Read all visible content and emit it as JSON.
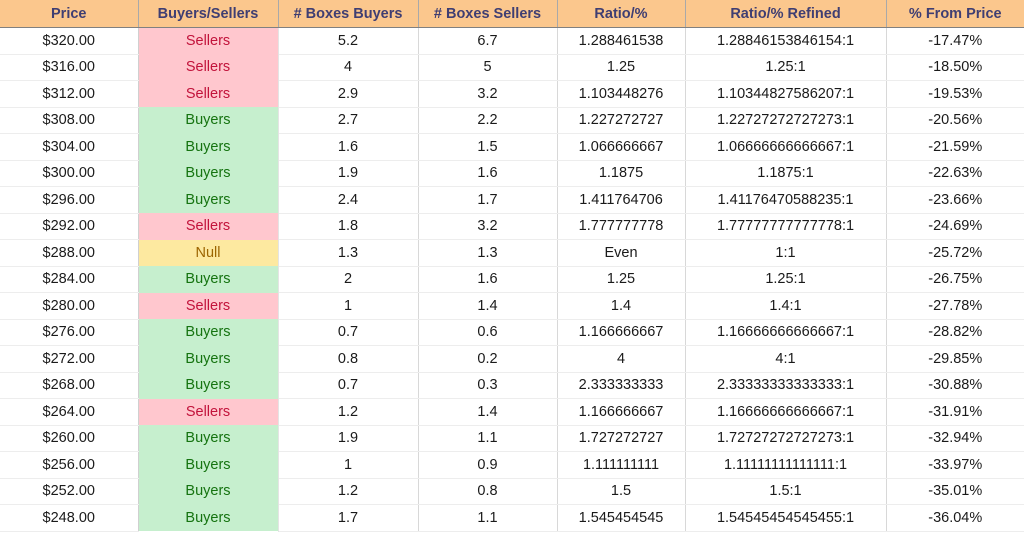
{
  "table": {
    "columns": [
      {
        "key": "price",
        "label": "Price"
      },
      {
        "key": "verdict",
        "label": "Buyers/Sellers"
      },
      {
        "key": "boxes_buyers",
        "label": "# Boxes Buyers"
      },
      {
        "key": "boxes_sellers",
        "label": "# Boxes Sellers"
      },
      {
        "key": "ratio",
        "label": "Ratio/%"
      },
      {
        "key": "refined",
        "label": "Ratio/% Refined"
      },
      {
        "key": "pct",
        "label": "% From Price"
      }
    ],
    "colors": {
      "header_bg": "#FBC78D",
      "header_text": "#3F3E72",
      "sellers_bg": "#FFC7CE",
      "sellers_text": "#C2133B",
      "buyers_bg": "#C6EFCE",
      "buyers_text": "#157310",
      "null_bg": "#FDE9A0",
      "null_text": "#9C6500"
    },
    "rows": [
      {
        "price": "$320.00",
        "verdict": "Sellers",
        "verdict_state": "sellers",
        "boxes_buyers": "5.2",
        "boxes_sellers": "6.7",
        "ratio": "1.288461538",
        "refined": "1.28846153846154:1",
        "pct": "-17.47%"
      },
      {
        "price": "$316.00",
        "verdict": "Sellers",
        "verdict_state": "sellers",
        "boxes_buyers": "4",
        "boxes_sellers": "5",
        "ratio": "1.25",
        "refined": "1.25:1",
        "pct": "-18.50%"
      },
      {
        "price": "$312.00",
        "verdict": "Sellers",
        "verdict_state": "sellers",
        "boxes_buyers": "2.9",
        "boxes_sellers": "3.2",
        "ratio": "1.103448276",
        "refined": "1.10344827586207:1",
        "pct": "-19.53%"
      },
      {
        "price": "$308.00",
        "verdict": "Buyers",
        "verdict_state": "buyers",
        "boxes_buyers": "2.7",
        "boxes_sellers": "2.2",
        "ratio": "1.227272727",
        "refined": "1.22727272727273:1",
        "pct": "-20.56%"
      },
      {
        "price": "$304.00",
        "verdict": "Buyers",
        "verdict_state": "buyers",
        "boxes_buyers": "1.6",
        "boxes_sellers": "1.5",
        "ratio": "1.066666667",
        "refined": "1.06666666666667:1",
        "pct": "-21.59%"
      },
      {
        "price": "$300.00",
        "verdict": "Buyers",
        "verdict_state": "buyers",
        "boxes_buyers": "1.9",
        "boxes_sellers": "1.6",
        "ratio": "1.1875",
        "refined": "1.1875:1",
        "pct": "-22.63%"
      },
      {
        "price": "$296.00",
        "verdict": "Buyers",
        "verdict_state": "buyers",
        "boxes_buyers": "2.4",
        "boxes_sellers": "1.7",
        "ratio": "1.411764706",
        "refined": "1.41176470588235:1",
        "pct": "-23.66%"
      },
      {
        "price": "$292.00",
        "verdict": "Sellers",
        "verdict_state": "sellers",
        "boxes_buyers": "1.8",
        "boxes_sellers": "3.2",
        "ratio": "1.777777778",
        "refined": "1.77777777777778:1",
        "pct": "-24.69%"
      },
      {
        "price": "$288.00",
        "verdict": "Null",
        "verdict_state": "null",
        "boxes_buyers": "1.3",
        "boxes_sellers": "1.3",
        "ratio": "Even",
        "refined": "1:1",
        "pct": "-25.72%"
      },
      {
        "price": "$284.00",
        "verdict": "Buyers",
        "verdict_state": "buyers",
        "boxes_buyers": "2",
        "boxes_sellers": "1.6",
        "ratio": "1.25",
        "refined": "1.25:1",
        "pct": "-26.75%"
      },
      {
        "price": "$280.00",
        "verdict": "Sellers",
        "verdict_state": "sellers",
        "boxes_buyers": "1",
        "boxes_sellers": "1.4",
        "ratio": "1.4",
        "refined": "1.4:1",
        "pct": "-27.78%"
      },
      {
        "price": "$276.00",
        "verdict": "Buyers",
        "verdict_state": "buyers",
        "boxes_buyers": "0.7",
        "boxes_sellers": "0.6",
        "ratio": "1.166666667",
        "refined": "1.16666666666667:1",
        "pct": "-28.82%"
      },
      {
        "price": "$272.00",
        "verdict": "Buyers",
        "verdict_state": "buyers",
        "boxes_buyers": "0.8",
        "boxes_sellers": "0.2",
        "ratio": "4",
        "refined": "4:1",
        "pct": "-29.85%"
      },
      {
        "price": "$268.00",
        "verdict": "Buyers",
        "verdict_state": "buyers",
        "boxes_buyers": "0.7",
        "boxes_sellers": "0.3",
        "ratio": "2.333333333",
        "refined": "2.33333333333333:1",
        "pct": "-30.88%"
      },
      {
        "price": "$264.00",
        "verdict": "Sellers",
        "verdict_state": "sellers",
        "boxes_buyers": "1.2",
        "boxes_sellers": "1.4",
        "ratio": "1.166666667",
        "refined": "1.16666666666667:1",
        "pct": "-31.91%"
      },
      {
        "price": "$260.00",
        "verdict": "Buyers",
        "verdict_state": "buyers",
        "boxes_buyers": "1.9",
        "boxes_sellers": "1.1",
        "ratio": "1.727272727",
        "refined": "1.72727272727273:1",
        "pct": "-32.94%"
      },
      {
        "price": "$256.00",
        "verdict": "Buyers",
        "verdict_state": "buyers",
        "boxes_buyers": "1",
        "boxes_sellers": "0.9",
        "ratio": "1.111111111",
        "refined": "1.11111111111111:1",
        "pct": "-33.97%"
      },
      {
        "price": "$252.00",
        "verdict": "Buyers",
        "verdict_state": "buyers",
        "boxes_buyers": "1.2",
        "boxes_sellers": "0.8",
        "ratio": "1.5",
        "refined": "1.5:1",
        "pct": "-35.01%"
      },
      {
        "price": "$248.00",
        "verdict": "Buyers",
        "verdict_state": "buyers",
        "boxes_buyers": "1.7",
        "boxes_sellers": "1.1",
        "ratio": "1.545454545",
        "refined": "1.54545454545455:1",
        "pct": "-36.04%"
      }
    ]
  }
}
